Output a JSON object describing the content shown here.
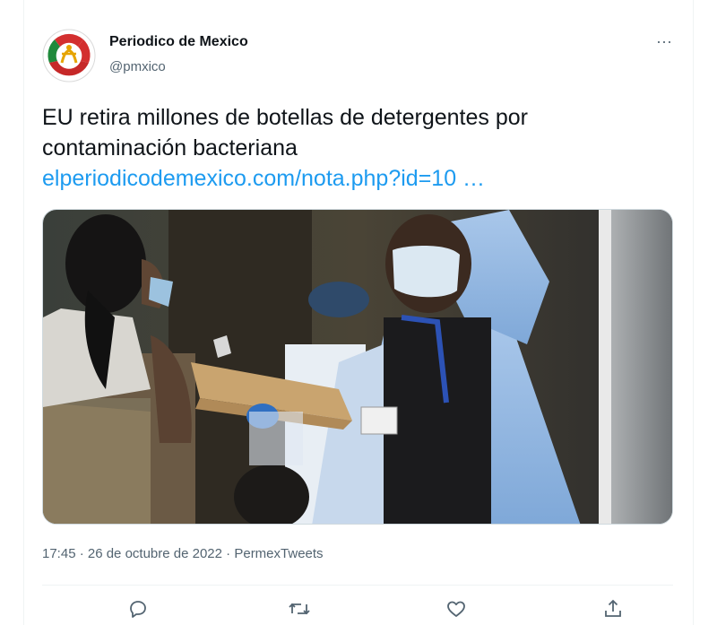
{
  "tweet": {
    "author_name": "Periodico de Mexico",
    "author_handle": "@pmxico",
    "more_label": "···",
    "text_line1": "EU retira millones de botellas de detergentes por",
    "text_line2": "contaminación bacteriana",
    "link_text": "elperiodicodemexico.com/nota.php?id=10 …",
    "timestamp": "17:45 · 26 de octubre de 2022",
    "separator": " · ",
    "source": "PermexTweets"
  },
  "actions": [
    {
      "name": "reply-icon"
    },
    {
      "name": "retweet-icon"
    },
    {
      "name": "like-icon"
    },
    {
      "name": "share-icon"
    }
  ],
  "colors": {
    "link": "#1d9bf0",
    "secondary_text": "#536471",
    "primary_text": "#0f1419"
  }
}
